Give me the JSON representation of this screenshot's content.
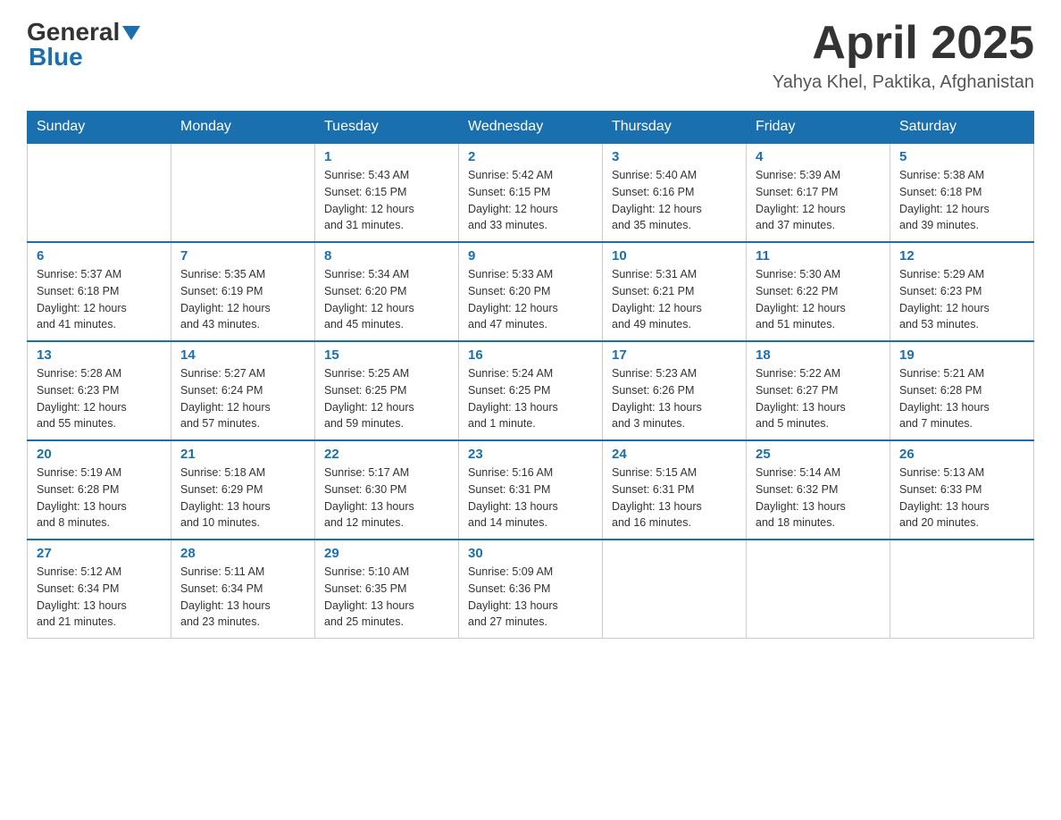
{
  "header": {
    "logo_general": "General",
    "logo_blue": "Blue",
    "title": "April 2025",
    "subtitle": "Yahya Khel, Paktika, Afghanistan"
  },
  "weekdays": [
    "Sunday",
    "Monday",
    "Tuesday",
    "Wednesday",
    "Thursday",
    "Friday",
    "Saturday"
  ],
  "weeks": [
    [
      {
        "day": "",
        "info": ""
      },
      {
        "day": "",
        "info": ""
      },
      {
        "day": "1",
        "info": "Sunrise: 5:43 AM\nSunset: 6:15 PM\nDaylight: 12 hours\nand 31 minutes."
      },
      {
        "day": "2",
        "info": "Sunrise: 5:42 AM\nSunset: 6:15 PM\nDaylight: 12 hours\nand 33 minutes."
      },
      {
        "day": "3",
        "info": "Sunrise: 5:40 AM\nSunset: 6:16 PM\nDaylight: 12 hours\nand 35 minutes."
      },
      {
        "day": "4",
        "info": "Sunrise: 5:39 AM\nSunset: 6:17 PM\nDaylight: 12 hours\nand 37 minutes."
      },
      {
        "day": "5",
        "info": "Sunrise: 5:38 AM\nSunset: 6:18 PM\nDaylight: 12 hours\nand 39 minutes."
      }
    ],
    [
      {
        "day": "6",
        "info": "Sunrise: 5:37 AM\nSunset: 6:18 PM\nDaylight: 12 hours\nand 41 minutes."
      },
      {
        "day": "7",
        "info": "Sunrise: 5:35 AM\nSunset: 6:19 PM\nDaylight: 12 hours\nand 43 minutes."
      },
      {
        "day": "8",
        "info": "Sunrise: 5:34 AM\nSunset: 6:20 PM\nDaylight: 12 hours\nand 45 minutes."
      },
      {
        "day": "9",
        "info": "Sunrise: 5:33 AM\nSunset: 6:20 PM\nDaylight: 12 hours\nand 47 minutes."
      },
      {
        "day": "10",
        "info": "Sunrise: 5:31 AM\nSunset: 6:21 PM\nDaylight: 12 hours\nand 49 minutes."
      },
      {
        "day": "11",
        "info": "Sunrise: 5:30 AM\nSunset: 6:22 PM\nDaylight: 12 hours\nand 51 minutes."
      },
      {
        "day": "12",
        "info": "Sunrise: 5:29 AM\nSunset: 6:23 PM\nDaylight: 12 hours\nand 53 minutes."
      }
    ],
    [
      {
        "day": "13",
        "info": "Sunrise: 5:28 AM\nSunset: 6:23 PM\nDaylight: 12 hours\nand 55 minutes."
      },
      {
        "day": "14",
        "info": "Sunrise: 5:27 AM\nSunset: 6:24 PM\nDaylight: 12 hours\nand 57 minutes."
      },
      {
        "day": "15",
        "info": "Sunrise: 5:25 AM\nSunset: 6:25 PM\nDaylight: 12 hours\nand 59 minutes."
      },
      {
        "day": "16",
        "info": "Sunrise: 5:24 AM\nSunset: 6:25 PM\nDaylight: 13 hours\nand 1 minute."
      },
      {
        "day": "17",
        "info": "Sunrise: 5:23 AM\nSunset: 6:26 PM\nDaylight: 13 hours\nand 3 minutes."
      },
      {
        "day": "18",
        "info": "Sunrise: 5:22 AM\nSunset: 6:27 PM\nDaylight: 13 hours\nand 5 minutes."
      },
      {
        "day": "19",
        "info": "Sunrise: 5:21 AM\nSunset: 6:28 PM\nDaylight: 13 hours\nand 7 minutes."
      }
    ],
    [
      {
        "day": "20",
        "info": "Sunrise: 5:19 AM\nSunset: 6:28 PM\nDaylight: 13 hours\nand 8 minutes."
      },
      {
        "day": "21",
        "info": "Sunrise: 5:18 AM\nSunset: 6:29 PM\nDaylight: 13 hours\nand 10 minutes."
      },
      {
        "day": "22",
        "info": "Sunrise: 5:17 AM\nSunset: 6:30 PM\nDaylight: 13 hours\nand 12 minutes."
      },
      {
        "day": "23",
        "info": "Sunrise: 5:16 AM\nSunset: 6:31 PM\nDaylight: 13 hours\nand 14 minutes."
      },
      {
        "day": "24",
        "info": "Sunrise: 5:15 AM\nSunset: 6:31 PM\nDaylight: 13 hours\nand 16 minutes."
      },
      {
        "day": "25",
        "info": "Sunrise: 5:14 AM\nSunset: 6:32 PM\nDaylight: 13 hours\nand 18 minutes."
      },
      {
        "day": "26",
        "info": "Sunrise: 5:13 AM\nSunset: 6:33 PM\nDaylight: 13 hours\nand 20 minutes."
      }
    ],
    [
      {
        "day": "27",
        "info": "Sunrise: 5:12 AM\nSunset: 6:34 PM\nDaylight: 13 hours\nand 21 minutes."
      },
      {
        "day": "28",
        "info": "Sunrise: 5:11 AM\nSunset: 6:34 PM\nDaylight: 13 hours\nand 23 minutes."
      },
      {
        "day": "29",
        "info": "Sunrise: 5:10 AM\nSunset: 6:35 PM\nDaylight: 13 hours\nand 25 minutes."
      },
      {
        "day": "30",
        "info": "Sunrise: 5:09 AM\nSunset: 6:36 PM\nDaylight: 13 hours\nand 27 minutes."
      },
      {
        "day": "",
        "info": ""
      },
      {
        "day": "",
        "info": ""
      },
      {
        "day": "",
        "info": ""
      }
    ]
  ]
}
